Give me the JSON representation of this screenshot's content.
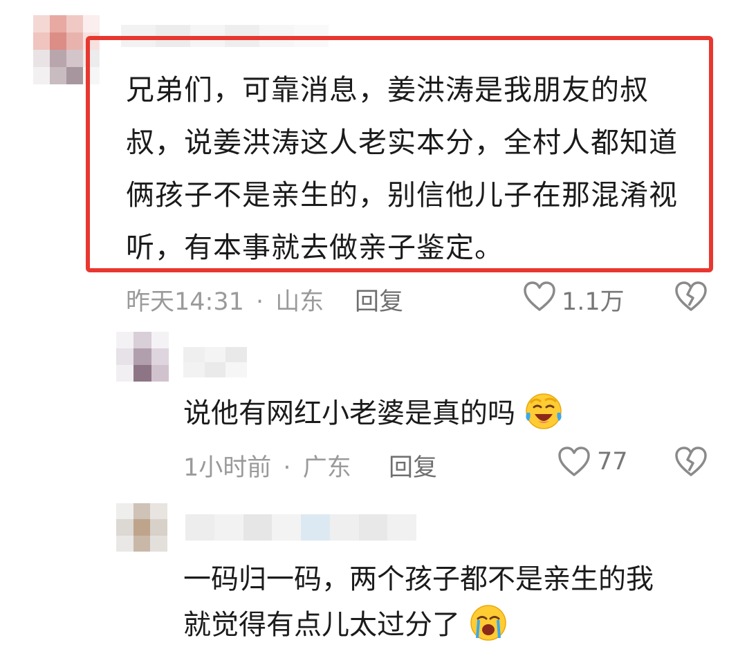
{
  "comments": [
    {
      "text": "兄弟们，可靠消息，姜洪涛是我朋友的叔叔，说姜洪涛这人老实本分，全村人都知道俩孩子不是亲生的，别信他儿子在那混淆视听，有本事就去做亲子鉴定。",
      "time": "昨天14:31",
      "location": "山东",
      "meta_separator": "·",
      "reply_label": "回复",
      "likes": "1.1万"
    },
    {
      "text": "说他有网红小老婆是真的吗",
      "time": "1小时前",
      "location": "广东",
      "meta_separator": "·",
      "reply_label": "回复",
      "likes": "77"
    },
    {
      "text_line1": "一码归一码，两个孩子都不是亲生的我",
      "text_line2": "就觉得有点儿太过分了"
    }
  ],
  "colors": {
    "highlight_border": "#e8372f",
    "meta_text": "#9a9a9a",
    "icon": "#8a8a8a"
  },
  "icons": [
    "heart-outline-icon",
    "broken-heart-icon",
    "laugh-cry-emoji-icon",
    "sob-emoji-icon"
  ]
}
